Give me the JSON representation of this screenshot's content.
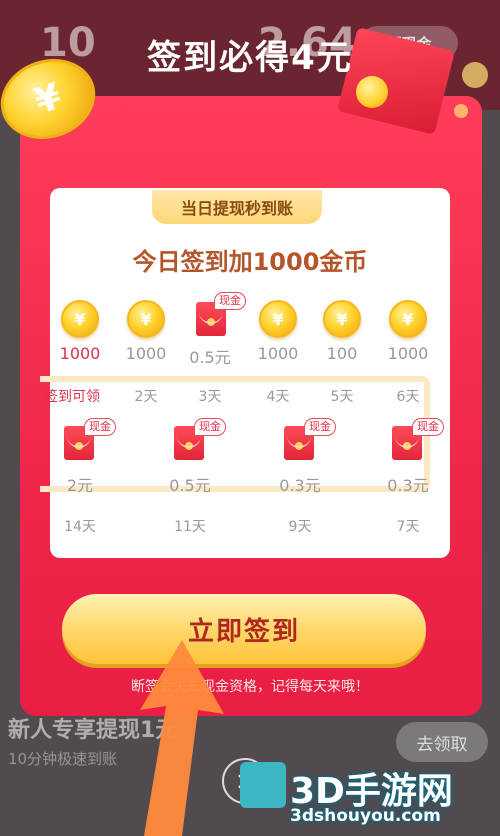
{
  "background": {
    "left_number": "10",
    "right_number": "2.64",
    "cash_pill_label": "领现金",
    "small_label": "",
    "row_title": "新人专享提现1元",
    "row_sub": "10分钟极速到账",
    "row_button": "去领取"
  },
  "modal": {
    "title": "签到必得4元",
    "ribbon": "当日提现秒到账",
    "card_title": "今日签到加1000金币",
    "week": [
      {
        "type": "coin",
        "amount": "1000",
        "day": "签到可领",
        "active": true
      },
      {
        "type": "coin",
        "amount": "1000",
        "day": "2天",
        "active": false
      },
      {
        "type": "envelope",
        "amount": "0.5元",
        "day": "3天",
        "active": false,
        "tag": "现金"
      },
      {
        "type": "coin",
        "amount": "1000",
        "day": "4天",
        "active": false
      },
      {
        "type": "coin",
        "amount": "100",
        "day": "5天",
        "active": false
      },
      {
        "type": "coin",
        "amount": "1000",
        "day": "6天",
        "active": false
      }
    ],
    "milestones": [
      {
        "amount": "2元",
        "day": "14天",
        "tag": "现金"
      },
      {
        "amount": "0.5元",
        "day": "11天",
        "tag": "现金"
      },
      {
        "amount": "0.3元",
        "day": "9天",
        "tag": "现金"
      },
      {
        "amount": "0.3元",
        "day": "7天",
        "tag": "现金"
      }
    ],
    "cta_label": "立即签到",
    "footnote": "断签会失去现金资格，记得每天来哦！",
    "coin_symbol": "¥"
  },
  "close_label": "×",
  "watermark": {
    "title": "3D手游网",
    "url": "3dshouyou.com"
  },
  "colors": {
    "modal_red": "#f0274a",
    "gold": "#ffd22e",
    "accent_text": "#b5562a"
  }
}
